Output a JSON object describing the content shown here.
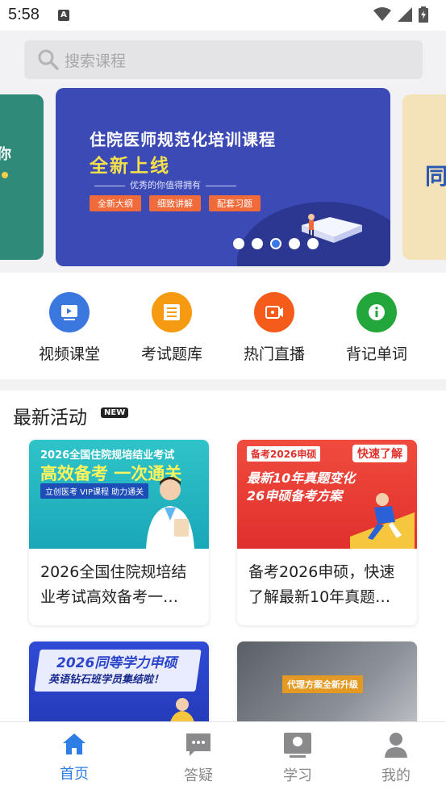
{
  "status_bar": {
    "time": "5:58",
    "notification_icon": "a-icon",
    "icons": [
      "wifi-icon",
      "signal-icon",
      "battery-icon"
    ]
  },
  "search": {
    "placeholder": "搜索课程",
    "icon": "search-icon"
  },
  "banner": {
    "title": "住院医师规范化培训课程",
    "subtitle": "全新上线",
    "tagline": "优秀的你值得拥有",
    "chips": [
      "全新大纲",
      "细致讲解",
      "配套习题"
    ],
    "dot_count": 5,
    "active_dot": 2,
    "left_peek_text": "你",
    "right_peek_text": "同"
  },
  "quick_nav": [
    {
      "label": "视频课堂",
      "icon": "video-icon",
      "color": "#3a78e0"
    },
    {
      "label": "考试题库",
      "icon": "question-bank-icon",
      "color": "#f59a11"
    },
    {
      "label": "热门直播",
      "icon": "live-camera-icon",
      "color": "#f55c1c"
    },
    {
      "label": "背记单词",
      "icon": "info-icon",
      "color": "#23a63a"
    }
  ],
  "activities": {
    "title": "最新活动",
    "badge": "NEW",
    "cards": [
      {
        "img_title": "2026全国住院规培结业考试",
        "img_headline": "高效备考 一次通关",
        "img_strip": "立创医考 VIP课程 助力通关",
        "caption": "2026全国住院规培结业考试高效备考一…"
      },
      {
        "img_title": "备考2026申硕",
        "img_tag": "快速了解",
        "img_headline": "最新10年真题变化",
        "img_headline2": "26申硕备考方案",
        "caption": "备考2026申硕，快速了解最新10年真题…"
      },
      {
        "img_title": "2026同等学力申硕",
        "img_headline": "英语钻石班学员集结啦！",
        "caption": ""
      },
      {
        "img_tag": "代理方案全新升级",
        "caption": ""
      }
    ]
  },
  "tabbar": [
    {
      "label": "首页",
      "icon": "home-icon",
      "active": true
    },
    {
      "label": "答疑",
      "icon": "chat-icon",
      "active": false
    },
    {
      "label": "学习",
      "icon": "study-icon",
      "active": false
    },
    {
      "label": "我的",
      "icon": "profile-icon",
      "active": false
    }
  ],
  "colors": {
    "accent": "#2f7de6",
    "banner_bg": "#3c4ab6",
    "inactive": "#888888"
  }
}
